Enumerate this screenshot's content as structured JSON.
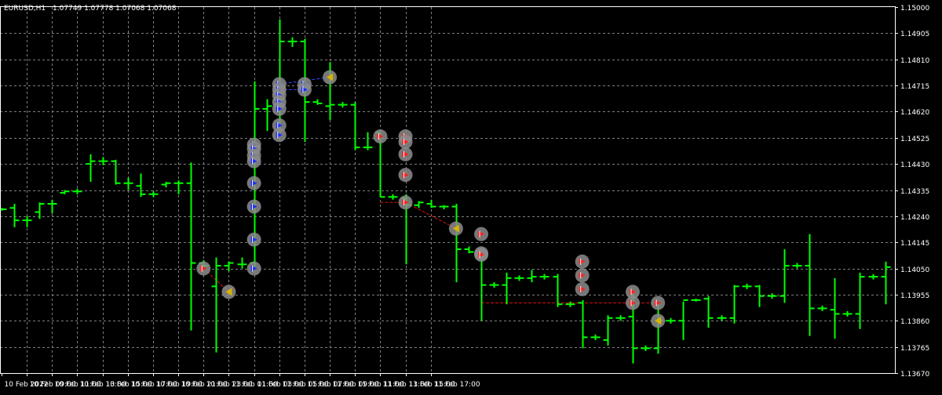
{
  "header": {
    "symbol": "EURUSD,H1",
    "ohlc": "1.07749 1.07778 1.07068 1.07068"
  },
  "colors": {
    "background": "#000000",
    "grid": "#7f7f7f",
    "axis": "#ffffff",
    "bar": "#00ff00",
    "marker_ring": "#8c8c8c",
    "buy_arrow": "#1f2bff",
    "sell_arrow": "#ff2020",
    "close_marker": "#d7b400",
    "buy_line": "#3d47ff",
    "sell_line": "#d81010"
  },
  "chart_data": {
    "type": "ohlc",
    "y_axis_ticks": [
      "1.15000",
      "1.14905",
      "1.14810",
      "1.14715",
      "1.14620",
      "1.14525",
      "1.14430",
      "1.14335",
      "1.14240",
      "1.14145",
      "1.14050",
      "1.13955",
      "1.13860",
      "1.13765",
      "1.13670"
    ],
    "x_axis_ticks": [
      "10 Feb 2022",
      "10 Feb 09:00",
      "10 Feb 11:00",
      "10 Feb 13:00",
      "10 Feb 15:00",
      "10 Feb 17:00",
      "10 Feb 19:00",
      "10 Feb 21:00",
      "10 Feb 23:00",
      "11 Feb 01:00",
      "11 Feb 03:00",
      "11 Feb 05:00",
      "11 Feb 07:00",
      "11 Feb 09:00",
      "11 Feb 11:00",
      "11 Feb 13:00",
      "11 Feb 15:00",
      "11 Feb 17:00"
    ],
    "ylim": [
      1.1367,
      1.15
    ],
    "grid": true,
    "x_tick_spacing_bars": 2,
    "bars": [
      {
        "o": 1.14265,
        "h": 1.1427,
        "l": 1.1426,
        "c": 1.14265
      },
      {
        "o": 1.1427,
        "h": 1.14285,
        "l": 1.142,
        "c": 1.14225
      },
      {
        "o": 1.14225,
        "h": 1.1424,
        "l": 1.142,
        "c": 1.14225
      },
      {
        "o": 1.14255,
        "h": 1.1429,
        "l": 1.1423,
        "c": 1.14285
      },
      {
        "o": 1.14285,
        "h": 1.143,
        "l": 1.1425,
        "c": 1.14285
      },
      {
        "o": 1.14325,
        "h": 1.14335,
        "l": 1.1432,
        "c": 1.1433
      },
      {
        "o": 1.1433,
        "h": 1.1434,
        "l": 1.1432,
        "c": 1.1433
      },
      {
        "o": 1.1443,
        "h": 1.14465,
        "l": 1.14365,
        "c": 1.1444
      },
      {
        "o": 1.1444,
        "h": 1.14455,
        "l": 1.14425,
        "c": 1.1444
      },
      {
        "o": 1.1444,
        "h": 1.14445,
        "l": 1.14355,
        "c": 1.1436
      },
      {
        "o": 1.1436,
        "h": 1.1438,
        "l": 1.14335,
        "c": 1.1436
      },
      {
        "o": 1.1435,
        "h": 1.14395,
        "l": 1.1431,
        "c": 1.1432
      },
      {
        "o": 1.1432,
        "h": 1.1433,
        "l": 1.1431,
        "c": 1.1432
      },
      {
        "o": 1.14355,
        "h": 1.14365,
        "l": 1.14345,
        "c": 1.1436
      },
      {
        "o": 1.1436,
        "h": 1.1437,
        "l": 1.1432,
        "c": 1.1436
      },
      {
        "o": 1.1436,
        "h": 1.14435,
        "l": 1.13825,
        "c": 1.1407
      },
      {
        "o": 1.1407,
        "h": 1.1408,
        "l": 1.1405,
        "c": 1.1406
      },
      {
        "o": 1.13985,
        "h": 1.1409,
        "l": 1.13745,
        "c": 1.1406
      },
      {
        "o": 1.1406,
        "h": 1.14075,
        "l": 1.1404,
        "c": 1.1407
      },
      {
        "o": 1.14065,
        "h": 1.1409,
        "l": 1.1405,
        "c": 1.14065
      },
      {
        "o": 1.1407,
        "h": 1.1473,
        "l": 1.14055,
        "c": 1.1463
      },
      {
        "o": 1.1463,
        "h": 1.14665,
        "l": 1.1455,
        "c": 1.1464
      },
      {
        "o": 1.147,
        "h": 1.14955,
        "l": 1.1453,
        "c": 1.14875
      },
      {
        "o": 1.14875,
        "h": 1.1489,
        "l": 1.14855,
        "c": 1.14875
      },
      {
        "o": 1.14875,
        "h": 1.14885,
        "l": 1.1451,
        "c": 1.14655
      },
      {
        "o": 1.14655,
        "h": 1.14665,
        "l": 1.14645,
        "c": 1.1465
      },
      {
        "o": 1.1464,
        "h": 1.148,
        "l": 1.1459,
        "c": 1.14645
      },
      {
        "o": 1.14645,
        "h": 1.14655,
        "l": 1.14635,
        "c": 1.14645
      },
      {
        "o": 1.14645,
        "h": 1.14655,
        "l": 1.1448,
        "c": 1.1449
      },
      {
        "o": 1.1449,
        "h": 1.14545,
        "l": 1.1448,
        "c": 1.1449
      },
      {
        "o": 1.14545,
        "h": 1.14545,
        "l": 1.1431,
        "c": 1.1431
      },
      {
        "o": 1.1431,
        "h": 1.1432,
        "l": 1.143,
        "c": 1.1431
      },
      {
        "o": 1.14305,
        "h": 1.1432,
        "l": 1.14065,
        "c": 1.1428
      },
      {
        "o": 1.1428,
        "h": 1.14295,
        "l": 1.1427,
        "c": 1.1429
      },
      {
        "o": 1.14285,
        "h": 1.143,
        "l": 1.1427,
        "c": 1.14275
      },
      {
        "o": 1.14275,
        "h": 1.1428,
        "l": 1.14265,
        "c": 1.14275
      },
      {
        "o": 1.14275,
        "h": 1.14285,
        "l": 1.14,
        "c": 1.1412
      },
      {
        "o": 1.1412,
        "h": 1.1413,
        "l": 1.14105,
        "c": 1.1411
      },
      {
        "o": 1.141,
        "h": 1.1411,
        "l": 1.1386,
        "c": 1.1399
      },
      {
        "o": 1.1399,
        "h": 1.14,
        "l": 1.1398,
        "c": 1.1399
      },
      {
        "o": 1.1399,
        "h": 1.14035,
        "l": 1.1392,
        "c": 1.14015
      },
      {
        "o": 1.14015,
        "h": 1.14025,
        "l": 1.14005,
        "c": 1.14015
      },
      {
        "o": 1.14015,
        "h": 1.14045,
        "l": 1.14,
        "c": 1.1402
      },
      {
        "o": 1.1402,
        "h": 1.1403,
        "l": 1.1401,
        "c": 1.1402
      },
      {
        "o": 1.1402,
        "h": 1.1403,
        "l": 1.1391,
        "c": 1.1392
      },
      {
        "o": 1.1392,
        "h": 1.1393,
        "l": 1.1391,
        "c": 1.1392
      },
      {
        "o": 1.13925,
        "h": 1.13935,
        "l": 1.1376,
        "c": 1.138
      },
      {
        "o": 1.138,
        "h": 1.1381,
        "l": 1.1379,
        "c": 1.138
      },
      {
        "o": 1.1379,
        "h": 1.1388,
        "l": 1.1377,
        "c": 1.1387
      },
      {
        "o": 1.1387,
        "h": 1.1388,
        "l": 1.1386,
        "c": 1.1387
      },
      {
        "o": 1.13875,
        "h": 1.13965,
        "l": 1.13705,
        "c": 1.1376
      },
      {
        "o": 1.1376,
        "h": 1.1377,
        "l": 1.1375,
        "c": 1.1376
      },
      {
        "o": 1.1376,
        "h": 1.1393,
        "l": 1.1374,
        "c": 1.1386
      },
      {
        "o": 1.1386,
        "h": 1.1387,
        "l": 1.1385,
        "c": 1.1386
      },
      {
        "o": 1.1386,
        "h": 1.1393,
        "l": 1.1379,
        "c": 1.13935
      },
      {
        "o": 1.13935,
        "h": 1.1394,
        "l": 1.1393,
        "c": 1.13935
      },
      {
        "o": 1.1394,
        "h": 1.1395,
        "l": 1.13835,
        "c": 1.1387
      },
      {
        "o": 1.1387,
        "h": 1.1388,
        "l": 1.1386,
        "c": 1.1387
      },
      {
        "o": 1.1387,
        "h": 1.1399,
        "l": 1.1385,
        "c": 1.13985
      },
      {
        "o": 1.13985,
        "h": 1.13995,
        "l": 1.13975,
        "c": 1.13985
      },
      {
        "o": 1.13985,
        "h": 1.1399,
        "l": 1.1391,
        "c": 1.1395
      },
      {
        "o": 1.1395,
        "h": 1.1396,
        "l": 1.1394,
        "c": 1.1395
      },
      {
        "o": 1.1395,
        "h": 1.1412,
        "l": 1.13925,
        "c": 1.1406
      },
      {
        "o": 1.1406,
        "h": 1.1407,
        "l": 1.1405,
        "c": 1.1406
      },
      {
        "o": 1.1406,
        "h": 1.14175,
        "l": 1.13805,
        "c": 1.13905
      },
      {
        "o": 1.13905,
        "h": 1.13915,
        "l": 1.13895,
        "c": 1.13905
      },
      {
        "o": 1.139,
        "h": 1.14015,
        "l": 1.13795,
        "c": 1.13885
      },
      {
        "o": 1.13885,
        "h": 1.13895,
        "l": 1.13875,
        "c": 1.13885
      },
      {
        "o": 1.13885,
        "h": 1.14035,
        "l": 1.1383,
        "c": 1.1402
      },
      {
        "o": 1.1402,
        "h": 1.1403,
        "l": 1.1401,
        "c": 1.1402
      },
      {
        "o": 1.1402,
        "h": 1.14075,
        "l": 1.1392,
        "c": 1.14055
      }
    ],
    "trades": [
      {
        "kind": "sell",
        "x": 16,
        "price": 1.1405
      },
      {
        "kind": "close",
        "x": 18,
        "price": 1.13965
      },
      {
        "kind": "buy",
        "x": 20,
        "price": 1.145
      },
      {
        "kind": "buy",
        "x": 20,
        "price": 1.14485
      },
      {
        "kind": "buy",
        "x": 20,
        "price": 1.1446
      },
      {
        "kind": "buy",
        "x": 20,
        "price": 1.1444
      },
      {
        "kind": "buy",
        "x": 20,
        "price": 1.1436
      },
      {
        "kind": "buy",
        "x": 20,
        "price": 1.14275
      },
      {
        "kind": "buy",
        "x": 20,
        "price": 1.14155
      },
      {
        "kind": "buy",
        "x": 20,
        "price": 1.1405
      },
      {
        "kind": "buy",
        "x": 22,
        "price": 1.1472
      },
      {
        "kind": "buy",
        "x": 22,
        "price": 1.147
      },
      {
        "kind": "buy",
        "x": 22,
        "price": 1.1468
      },
      {
        "kind": "buy",
        "x": 22,
        "price": 1.14655
      },
      {
        "kind": "buy",
        "x": 22,
        "price": 1.1463
      },
      {
        "kind": "buy",
        "x": 22,
        "price": 1.1457
      },
      {
        "kind": "buy",
        "x": 22,
        "price": 1.14535
      },
      {
        "kind": "buy",
        "x": 24,
        "price": 1.1472
      },
      {
        "kind": "buy",
        "x": 24,
        "price": 1.147
      },
      {
        "kind": "close",
        "x": 26,
        "price": 1.14745
      },
      {
        "kind": "sell",
        "x": 30,
        "price": 1.1453
      },
      {
        "kind": "sell",
        "x": 32,
        "price": 1.1453
      },
      {
        "kind": "sell",
        "x": 32,
        "price": 1.1451
      },
      {
        "kind": "sell",
        "x": 32,
        "price": 1.14465
      },
      {
        "kind": "sell",
        "x": 32,
        "price": 1.1439
      },
      {
        "kind": "sell",
        "x": 32,
        "price": 1.1429
      },
      {
        "kind": "close",
        "x": 36,
        "price": 1.14195
      },
      {
        "kind": "sell",
        "x": 38,
        "price": 1.14175
      },
      {
        "kind": "sell",
        "x": 38,
        "price": 1.14105
      },
      {
        "kind": "sell",
        "x": 38,
        "price": 1.141
      },
      {
        "kind": "sell",
        "x": 46,
        "price": 1.14075
      },
      {
        "kind": "sell",
        "x": 46,
        "price": 1.14025
      },
      {
        "kind": "sell",
        "x": 46,
        "price": 1.13975
      },
      {
        "kind": "sell",
        "x": 50,
        "price": 1.13965
      },
      {
        "kind": "sell",
        "x": 50,
        "price": 1.13925
      },
      {
        "kind": "sell",
        "x": 52,
        "price": 1.13925
      },
      {
        "kind": "close",
        "x": 52,
        "price": 1.1386
      }
    ],
    "trade_lines": [
      {
        "kind": "sell",
        "from": [
          16,
          1.1405
        ],
        "to": [
          18,
          1.13965
        ]
      },
      {
        "kind": "buy",
        "from": [
          22,
          1.1472
        ],
        "to": [
          26,
          1.14745
        ]
      },
      {
        "kind": "buy",
        "from": [
          22,
          1.147
        ],
        "to": [
          24,
          1.147
        ]
      },
      {
        "kind": "sell",
        "from": [
          30,
          1.1429
        ],
        "to": [
          32,
          1.1429
        ]
      },
      {
        "kind": "sell",
        "from": [
          32,
          1.1429
        ],
        "to": [
          36,
          1.14195
        ]
      },
      {
        "kind": "sell",
        "from": [
          38,
          1.13925
        ],
        "to": [
          52,
          1.13925
        ]
      }
    ]
  }
}
